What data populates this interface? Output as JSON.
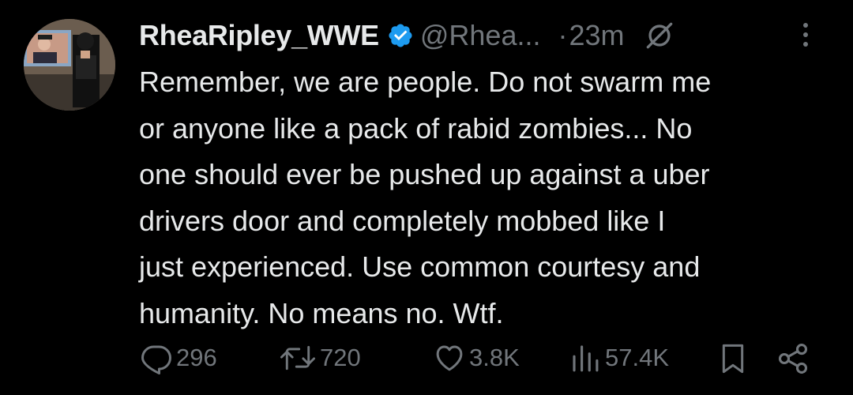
{
  "tweet": {
    "author_name": "RheaRipley_WWE",
    "handle": "@Rhea...",
    "separator": "·",
    "time": "23m",
    "lines": [
      "Remember, we are people. Do not swarm me",
      "or anyone like a pack of rabid zombies... No",
      "one should ever be pushed up against a uber",
      "drivers door and completely mobbed like I",
      "just experienced. Use common courtesy and",
      "humanity. No means no. Wtf."
    ]
  },
  "stats": {
    "replies": "296",
    "retweets": "720",
    "likes": "3.8K",
    "views": "57.4K"
  },
  "icons": {
    "verified": "verified-badge-icon",
    "grok": "grok-icon",
    "more": "more-options-icon",
    "reply": "reply-icon",
    "retweet": "retweet-icon",
    "like": "like-icon",
    "views": "views-icon",
    "bookmark": "bookmark-icon",
    "share": "share-icon"
  },
  "colors": {
    "background": "#000000",
    "text": "#e7e9ea",
    "muted": "#71767b",
    "verified": "#1d9bf0"
  }
}
